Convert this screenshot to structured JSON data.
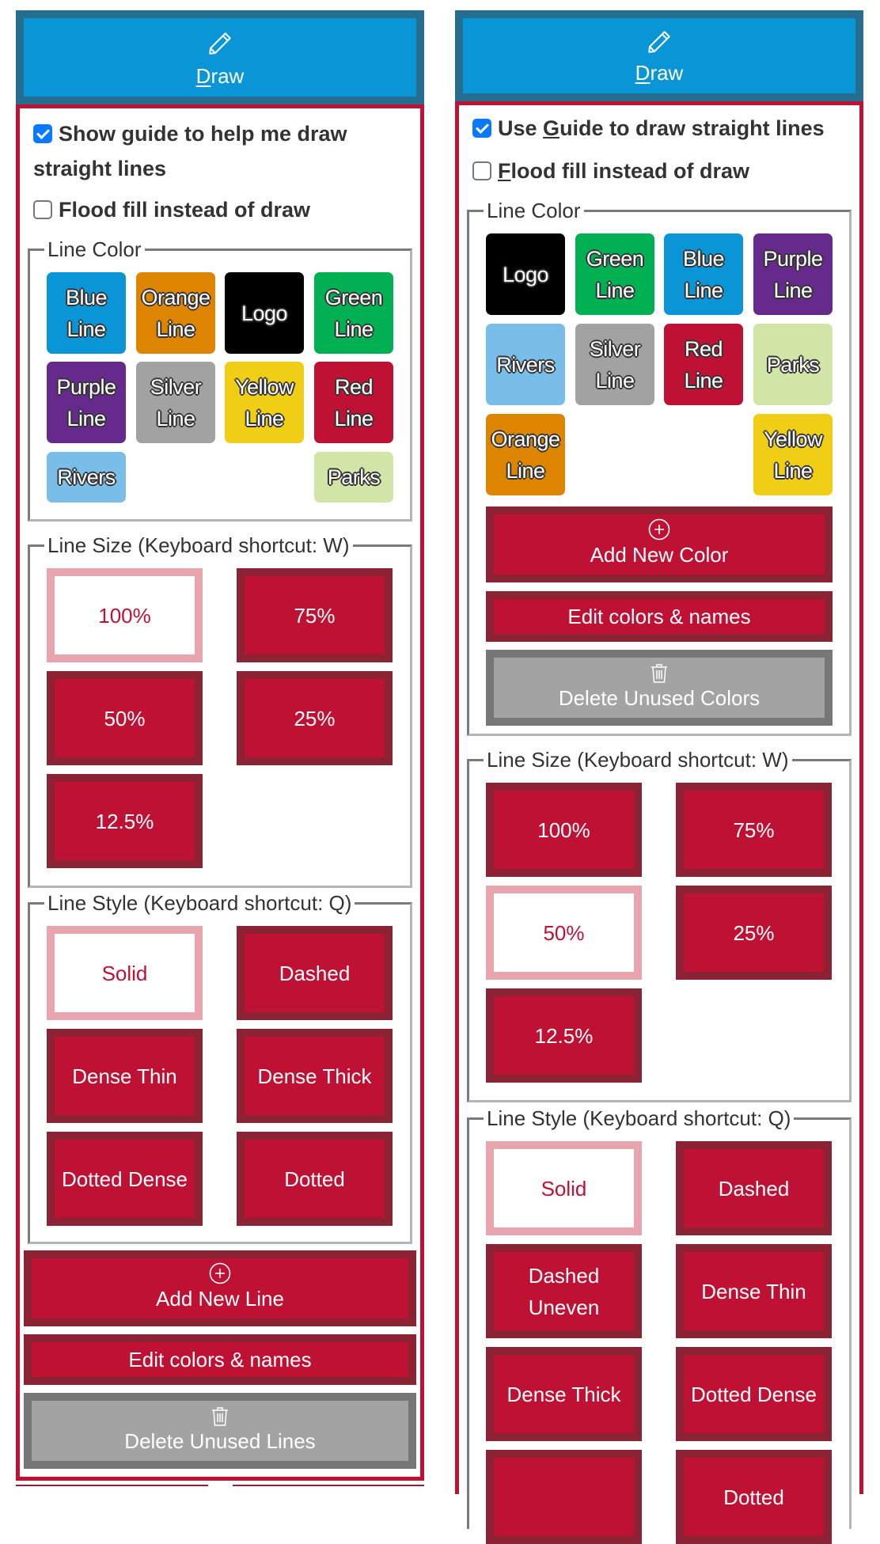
{
  "panels": [
    {
      "header": {
        "title_underlined": "D",
        "title_rest": "raw",
        "icon": "pencil-icon"
      },
      "checkboxes": [
        {
          "label": "Show guide to help me draw straight lines",
          "checked": true
        },
        {
          "label": "Flood fill instead of draw",
          "checked": false
        }
      ],
      "line_color": {
        "legend": "Line Color",
        "chips": [
          {
            "label": "Blue Line",
            "color": "#0A96D6"
          },
          {
            "label": "Orange Line",
            "color": "#DD8500"
          },
          {
            "label": "Logo",
            "color": "#000000"
          },
          {
            "label": "Green Line",
            "color": "#00B052"
          },
          {
            "label": "Purple Line",
            "color": "#652A8C"
          },
          {
            "label": "Silver Line",
            "color": "#A2A2A2"
          },
          {
            "label": "Yellow Line",
            "color": "#F0CE15"
          },
          {
            "label": "Red Line",
            "color": "#BE1134"
          },
          {
            "label": "Rivers",
            "color": "#79BDE9"
          },
          {
            "label": "Parks",
            "color": "#D0E5A6"
          }
        ]
      },
      "line_size": {
        "legend": "Line Size (Keyboard shortcut: W)",
        "options": [
          "100%",
          "75%",
          "50%",
          "25%",
          "12.5%"
        ],
        "selected": "100%"
      },
      "line_style": {
        "legend": "Line Style (Keyboard shortcut: Q)",
        "options": [
          "Solid",
          "Dashed",
          "Dense Thin",
          "Dense Thick",
          "Dotted Dense",
          "Dotted"
        ],
        "selected": "Solid"
      },
      "actions": {
        "add": "Add New Line",
        "edit": "Edit colors & names",
        "delete": "Delete Unused Lines"
      }
    },
    {
      "header": {
        "title_underlined": "D",
        "title_rest": "raw",
        "icon": "pencil-icon"
      },
      "checkboxes": [
        {
          "label_pre": "Use ",
          "label_key": "G",
          "label_post": "uide to draw straight lines",
          "checked": true
        },
        {
          "label_pre": "",
          "label_key": "F",
          "label_post": "lood fill instead of draw",
          "checked": false
        }
      ],
      "line_color": {
        "legend": "Line Color",
        "chips": [
          {
            "label": "Logo",
            "color": "#000000"
          },
          {
            "label": "Green Line",
            "color": "#00B052"
          },
          {
            "label": "Blue Line",
            "color": "#0A96D6"
          },
          {
            "label": "Purple Line",
            "color": "#652A8C"
          },
          {
            "label": "Rivers",
            "color": "#79BDE9"
          },
          {
            "label": "Silver Line",
            "color": "#A2A2A2"
          },
          {
            "label": "Red Line",
            "color": "#BE1134"
          },
          {
            "label": "Parks",
            "color": "#D0E5A6"
          },
          {
            "label": "Orange Line",
            "color": "#DD8500"
          },
          {
            "label": "Yellow Line",
            "color": "#F0CE15"
          }
        ],
        "add": "Add New Color",
        "edit": "Edit colors & names",
        "delete": "Delete Unused Colors"
      },
      "line_size": {
        "legend": "Line Size (Keyboard shortcut: W)",
        "options": [
          "100%",
          "75%",
          "50%",
          "25%",
          "12.5%"
        ],
        "selected": "50%"
      },
      "line_style": {
        "legend": "Line Style (Keyboard shortcut: Q)",
        "options": [
          "Solid",
          "Dashed",
          "Dashed Uneven",
          "Dense Thin",
          "Dense Thick",
          "Dotted Dense",
          "",
          "Dotted"
        ],
        "selected": "Solid"
      }
    }
  ],
  "colors": {
    "header_fill": "#0A96D6",
    "header_border": "#266E90",
    "accent": "#BE1134",
    "accent_border": "#8B2335",
    "selected_border": "#E8A5AE",
    "disabled_fill": "#A3A3A3",
    "disabled_border": "#777777"
  }
}
